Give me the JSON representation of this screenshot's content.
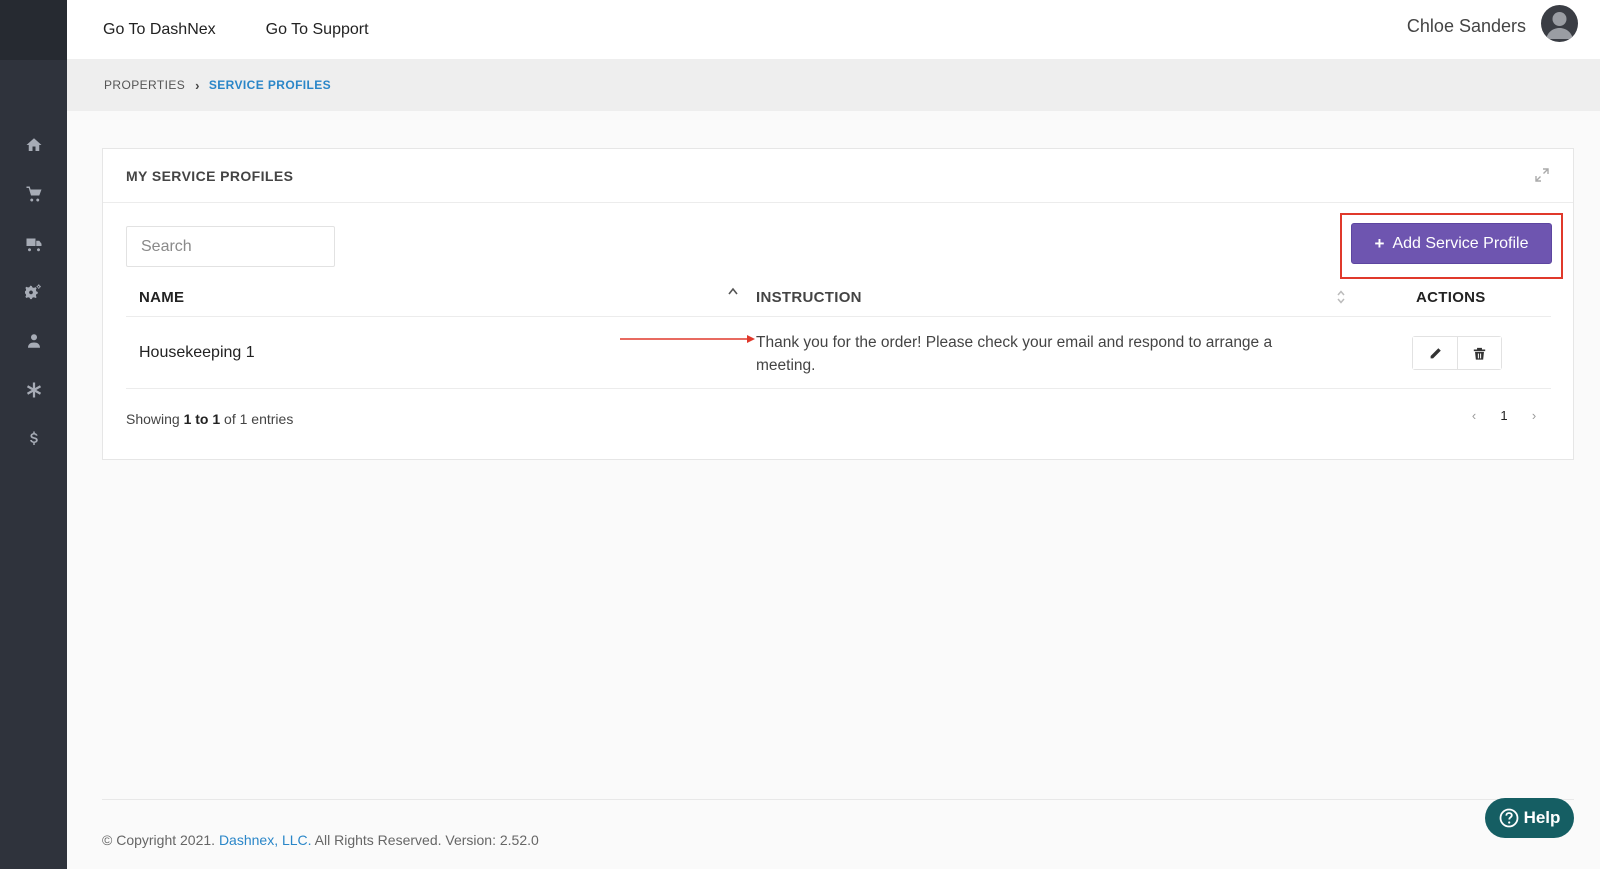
{
  "topbar": {
    "link1": "Go To DashNex",
    "link2": "Go To Support",
    "user_name": "Chloe Sanders"
  },
  "sidebar": {
    "items": [
      "home-icon",
      "cart-icon",
      "truck-icon",
      "gears-icon",
      "user-icon",
      "asterisk-icon",
      "dollar-icon"
    ]
  },
  "breadcrumb": {
    "parent": "PROPERTIES",
    "current": "SERVICE PROFILES"
  },
  "card": {
    "title": "MY SERVICE PROFILES",
    "search_placeholder": "Search",
    "add_button": "Add Service Profile",
    "add_button_icon": "+"
  },
  "table": {
    "headers": {
      "name": "NAME",
      "instruction": "INSTRUCTION",
      "actions": "ACTIONS"
    },
    "rows": [
      {
        "name": "Housekeeping 1",
        "instruction": "Thank you for the order! Please check your email and respond to arrange a meeting."
      }
    ]
  },
  "pagination": {
    "showing_prefix": "Showing ",
    "range": "1 to 1",
    "suffix": " of 1 entries",
    "prev": "‹",
    "page": "1",
    "next": "›"
  },
  "footer": {
    "prefix": "© Copyright 2021. ",
    "company": "Dashnex, LLC.",
    "suffix": " All Rights Reserved. Version: 2.52.0"
  },
  "help": {
    "label": "Help"
  },
  "colors": {
    "sidebar": "#2f333c",
    "accent_button": "#6e55b0",
    "breadcrumb_active": "#2a86c8",
    "highlight": "#e0392b",
    "help": "#155e63"
  }
}
